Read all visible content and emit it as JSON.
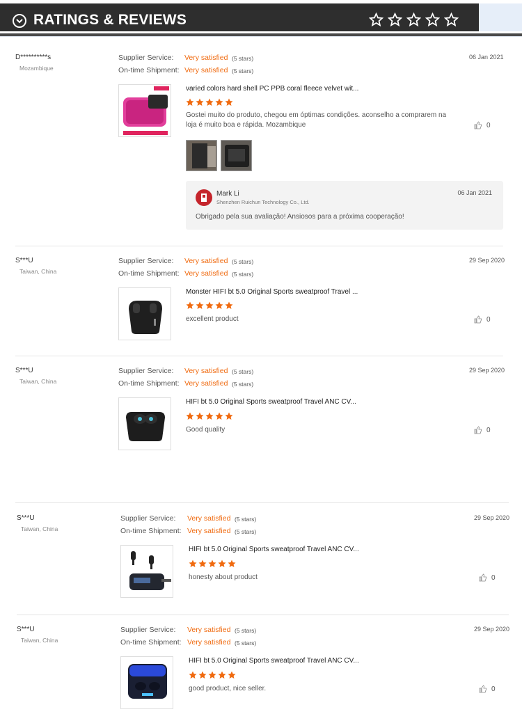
{
  "header": {
    "title": "RATINGS & REVIEWS",
    "star_count": 5,
    "accent": "#2e2e2e"
  },
  "labels": {
    "supplier_service": "Supplier Service:",
    "on_time_shipment": "On-time Shipment:",
    "very_satisfied": "Very satisfied",
    "five_stars": "(5 stars)"
  },
  "colors": {
    "orange": "#f06a0f",
    "star": "#f06a0f"
  },
  "reviews": [
    {
      "user": "D**********s",
      "location": "Mozambique",
      "date": "06 Jan 2021",
      "product": "varied colors hard shell PC PPB coral fleece velvet wit...",
      "rating": 5,
      "text": "Gostei muito do produto, chegou em óptimas condições. aconselho a comprarem na loja é muito boa e rápida. Mozambique",
      "likes": "0",
      "photos": 2,
      "reply": {
        "name": "Mark Li",
        "company": "Shenzhen Ruichun Technology Co., Ltd.",
        "date": "06 Jan 2021",
        "text": "Obrigado pela sua avaliação! Ansiosos para a próxima cooperação!"
      }
    },
    {
      "user": "S***U",
      "location": "Taiwan, China",
      "date": "29 Sep 2020",
      "product": "Monster HIFI bt 5.0 Original Sports sweatproof Travel ...",
      "rating": 5,
      "text": "excellent product",
      "likes": "0"
    },
    {
      "user": "S***U",
      "location": "Taiwan, China",
      "date": "29 Sep 2020",
      "product": "HIFI bt 5.0 Original Sports sweatproof Travel ANC CV...",
      "rating": 5,
      "text": "Good quality",
      "likes": "0"
    },
    {
      "user": "S***U",
      "location": "Taiwan, China",
      "date": "29 Sep 2020",
      "product": "HIFI bt 5.0 Original Sports sweatproof Travel ANC CV...",
      "rating": 5,
      "text": "honesty about product",
      "likes": "0"
    },
    {
      "user": "S***U",
      "location": "Taiwan, China",
      "date": "29 Sep 2020",
      "product": "HIFI bt 5.0 Original Sports sweatproof Travel ANC CV...",
      "rating": 5,
      "text": "good product, nice seller.",
      "likes": "0"
    }
  ]
}
